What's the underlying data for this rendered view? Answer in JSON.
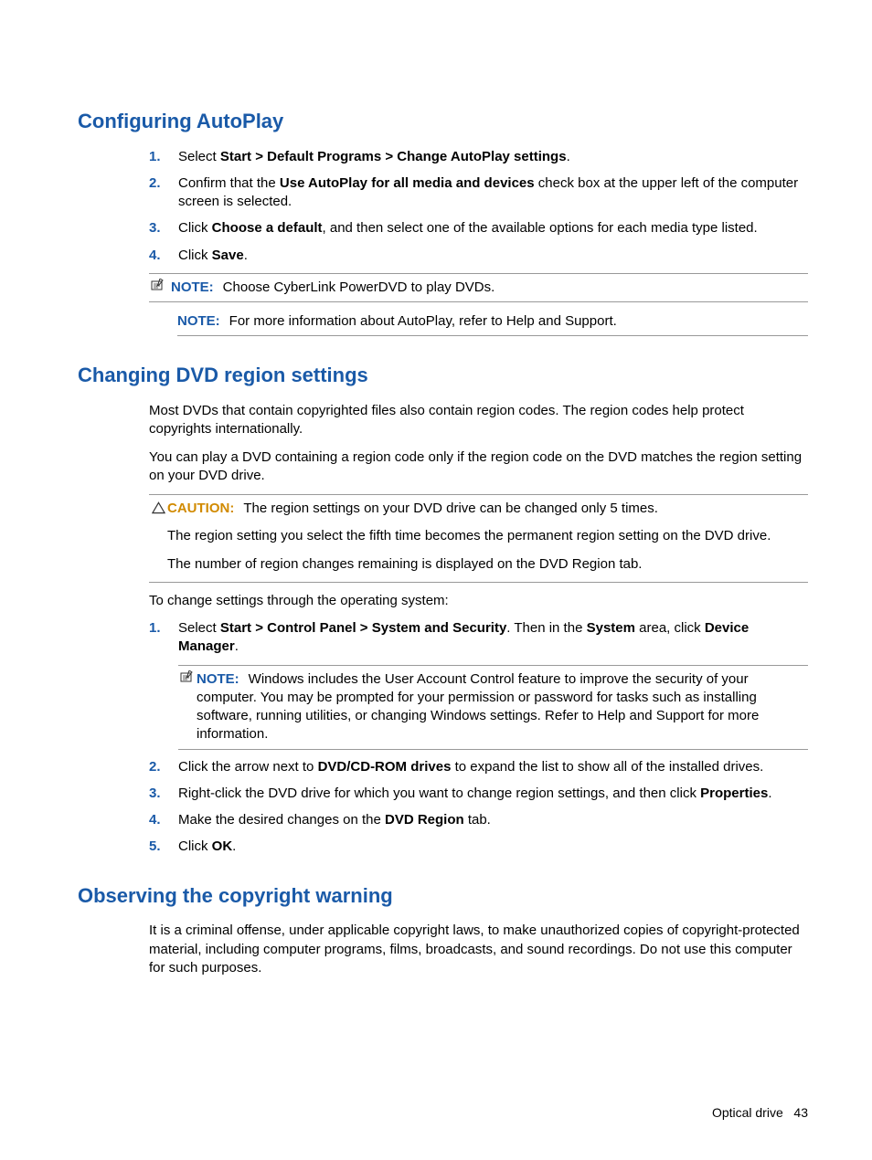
{
  "section1": {
    "title": "Configuring AutoPlay",
    "steps": [
      {
        "n": "1.",
        "pre": "Select ",
        "bold": "Start > Default Programs > Change AutoPlay settings",
        "post": "."
      },
      {
        "n": "2.",
        "pre": "Confirm that the ",
        "bold": "Use AutoPlay for all media and devices",
        "post": " check box at the upper left of the computer screen is selected."
      },
      {
        "n": "3.",
        "pre": "Click ",
        "bold": "Choose a default",
        "post": ", and then select one of the available options for each media type listed."
      },
      {
        "n": "4.",
        "pre": "Click ",
        "bold": "Save",
        "post": "."
      }
    ],
    "note1": {
      "label": "NOTE:",
      "text": "Choose CyberLink PowerDVD to play DVDs."
    },
    "note2": {
      "label": "NOTE:",
      "text": "For more information about AutoPlay, refer to Help and Support."
    }
  },
  "section2": {
    "title": "Changing DVD region settings",
    "p1": "Most DVDs that contain copyrighted files also contain region codes. The region codes help protect copyrights internationally.",
    "p2": "You can play a DVD containing a region code only if the region code on the DVD matches the region setting on your DVD drive.",
    "caution": {
      "label": "CAUTION:",
      "l1": "The region settings on your DVD drive can be changed only 5 times.",
      "l2": "The region setting you select the fifth time becomes the permanent region setting on the DVD drive.",
      "l3": "The number of region changes remaining is displayed on the DVD Region tab."
    },
    "p3": "To change settings through the operating system:",
    "step1": {
      "n": "1.",
      "pre": "Select ",
      "b1": "Start > Control Panel > System and Security",
      "mid": ". Then in the ",
      "b2": "System",
      "mid2": " area, click ",
      "b3": "Device Manager",
      "post": "."
    },
    "noteUAC": {
      "label": "NOTE:",
      "text": "Windows includes the User Account Control feature to improve the security of your computer. You may be prompted for your permission or password for tasks such as installing software, running utilities, or changing Windows settings. Refer to Help and Support for more information."
    },
    "step2": {
      "n": "2.",
      "pre": "Click the arrow next to ",
      "bold": "DVD/CD-ROM drives",
      "post": " to expand the list to show all of the installed drives."
    },
    "step3": {
      "n": "3.",
      "pre": "Right-click the DVD drive for which you want to change region settings, and then click ",
      "bold": "Properties",
      "post": "."
    },
    "step4": {
      "n": "4.",
      "pre": "Make the desired changes on the ",
      "bold": "DVD Region",
      "post": " tab."
    },
    "step5": {
      "n": "5.",
      "pre": "Click ",
      "bold": "OK",
      "post": "."
    }
  },
  "section3": {
    "title": "Observing the copyright warning",
    "p1": "It is a criminal offense, under applicable copyright laws, to make unauthorized copies of copyright-protected material, including computer programs, films, broadcasts, and sound recordings. Do not use this computer for such purposes."
  },
  "footer": {
    "label": "Optical drive",
    "page": "43"
  }
}
